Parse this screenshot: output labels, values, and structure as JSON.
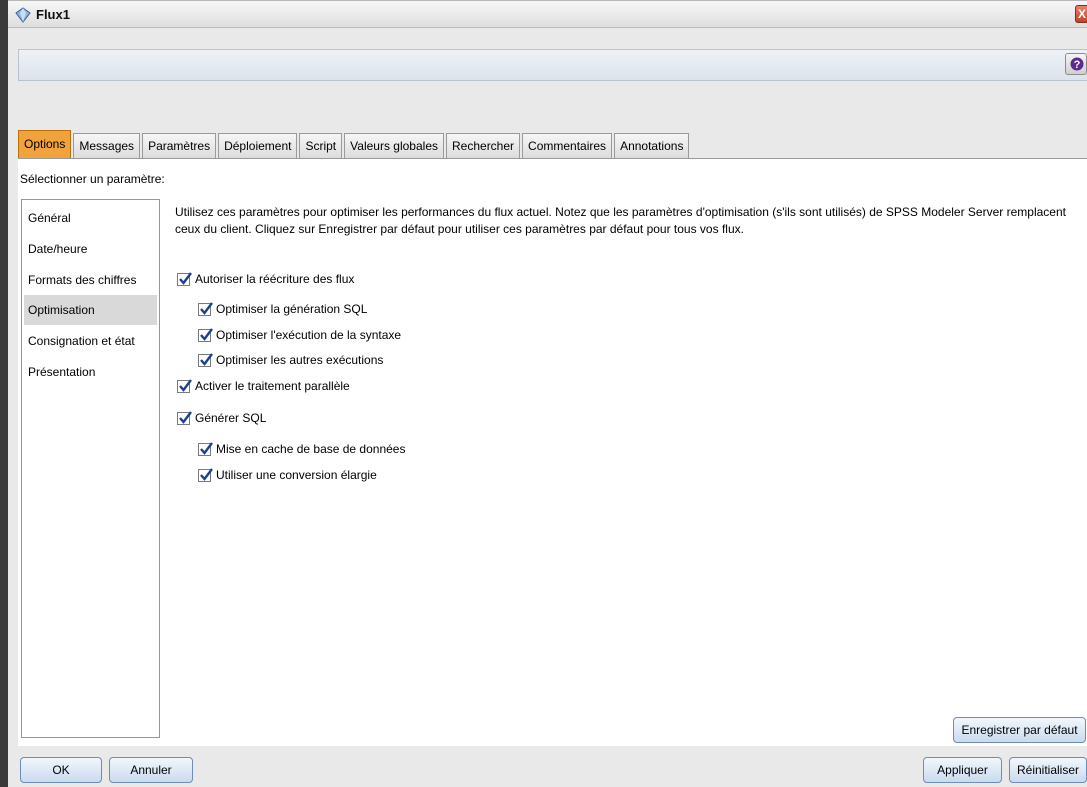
{
  "window": {
    "title": "Flux1",
    "close_glyph": "X",
    "help_icon": "question-mark-help-icon",
    "app_icon": "stream-diamond-icon"
  },
  "tabs": [
    {
      "label": "Options",
      "active": true
    },
    {
      "label": "Messages",
      "active": false
    },
    {
      "label": "Paramètres",
      "active": false
    },
    {
      "label": "Déploiement",
      "active": false
    },
    {
      "label": "Script",
      "active": false
    },
    {
      "label": "Valeurs globales",
      "active": false
    },
    {
      "label": "Rechercher",
      "active": false
    },
    {
      "label": "Commentaires",
      "active": false
    },
    {
      "label": "Annotations",
      "active": false
    }
  ],
  "settings": {
    "select_label": "Sélectionner un paramètre:",
    "items": [
      {
        "label": "Général",
        "selected": false
      },
      {
        "label": "Date/heure",
        "selected": false
      },
      {
        "label": "Formats des chiffres",
        "selected": false
      },
      {
        "label": "Optimisation",
        "selected": true
      },
      {
        "label": "Consignation et état",
        "selected": false
      },
      {
        "label": "Présentation",
        "selected": false
      }
    ]
  },
  "optimization": {
    "description": "Utilisez ces paramètres pour optimiser les performances du flux actuel. Notez que les paramètres d'optimisation (s'ils sont utilisés) de SPSS Modeler Server remplacent ceux du client. Cliquez sur Enregistrer par défaut pour utiliser ces paramètres par défaut pour tous vos flux.",
    "checkboxes": [
      {
        "label": "Autoriser la réécriture des flux",
        "checked": true
      },
      {
        "label": "Optimiser la génération SQL",
        "checked": true
      },
      {
        "label": "Optimiser l'exécution de la syntaxe",
        "checked": true
      },
      {
        "label": "Optimiser les autres exécutions",
        "checked": true
      },
      {
        "label": "Activer le traitement parallèle",
        "checked": true
      },
      {
        "label": "Générer SQL",
        "checked": true
      },
      {
        "label": "Mise en cache de base de données",
        "checked": true
      },
      {
        "label": "Utiliser une conversion élargie",
        "checked": true
      }
    ]
  },
  "buttons": {
    "save_default": "Enregistrer par défaut",
    "ok": "OK",
    "cancel": "Annuler",
    "apply": "Appliquer",
    "reset": "Réinitialiser"
  },
  "colors": {
    "active_tab": "#f0a33a",
    "checkmark": "#1b3f91",
    "button_border": "#6f8db3",
    "close_button": "#c1412b"
  }
}
